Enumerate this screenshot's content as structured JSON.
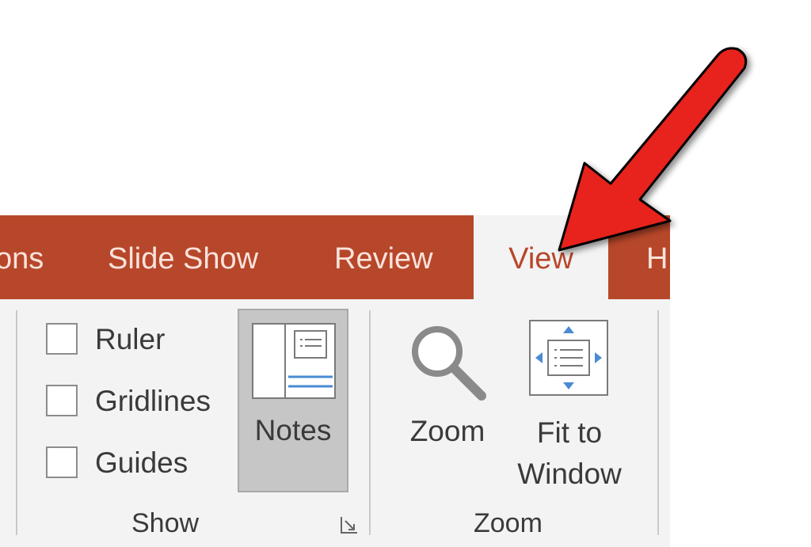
{
  "tabs": [
    {
      "label": "ons"
    },
    {
      "label": "Slide Show"
    },
    {
      "label": "Review"
    },
    {
      "label": "View"
    },
    {
      "label": "H"
    }
  ],
  "show_group": {
    "checkboxes": [
      {
        "label": "Ruler",
        "checked": false
      },
      {
        "label": "Gridlines",
        "checked": false
      },
      {
        "label": "Guides",
        "checked": false
      }
    ],
    "notes_label": "Notes",
    "group_label": "Show"
  },
  "zoom_group": {
    "zoom_label": "Zoom",
    "fit_line1": "Fit to",
    "fit_line2": "Window",
    "group_label": "Zoom"
  },
  "colors": {
    "tab_bar": "#b7472a",
    "ribbon": "#f3f3f3",
    "arrow": "#e8211c",
    "notes_pressed": "#c6c6c6"
  }
}
